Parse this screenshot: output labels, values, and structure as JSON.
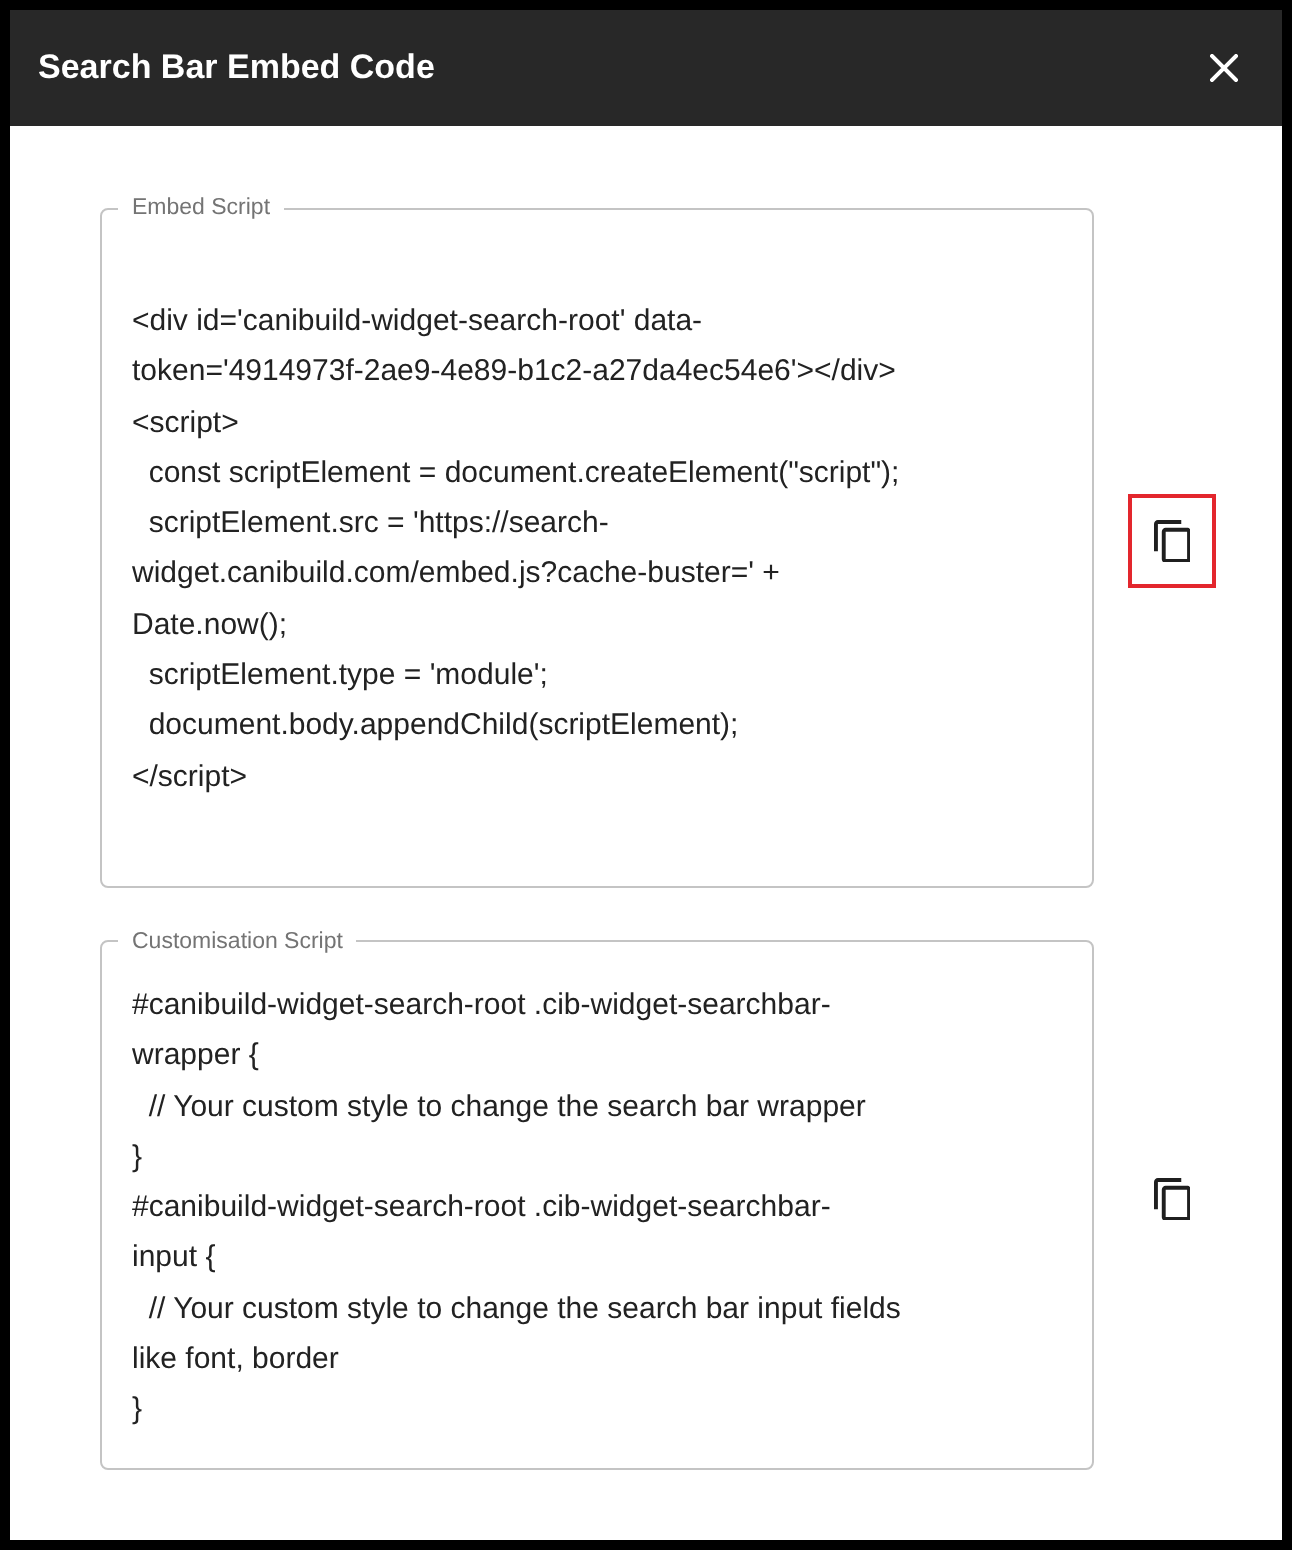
{
  "dialog": {
    "title": "Search Bar Embed Code"
  },
  "fields": [
    {
      "label": "Embed Script",
      "lines": [
        "<div id='canibuild-widget-search-root' data-",
        "token='4914973f-2ae9-4e89-b1c2-a27da4ec54e6'></div>",
        "<script>",
        "  const scriptElement = document.createElement(\"script\");",
        "  scriptElement.src = 'https://search-",
        "widget.canibuild.com/embed.js?cache-buster=' +",
        "Date.now();",
        "  scriptElement.type = 'module';",
        "  document.body.appendChild(scriptElement);",
        "</script>"
      ],
      "copy_button": {
        "highlighted": true
      }
    },
    {
      "label": "Customisation Script",
      "lines": [
        "#canibuild-widget-search-root .cib-widget-searchbar-",
        "wrapper {",
        "  // Your custom style to change the search bar wrapper",
        "}",
        "#canibuild-widget-search-root .cib-widget-searchbar-",
        "input {",
        "  // Your custom style to change the search bar input fields",
        "like font, border",
        "}"
      ],
      "copy_button": {
        "highlighted": false
      }
    }
  ]
}
